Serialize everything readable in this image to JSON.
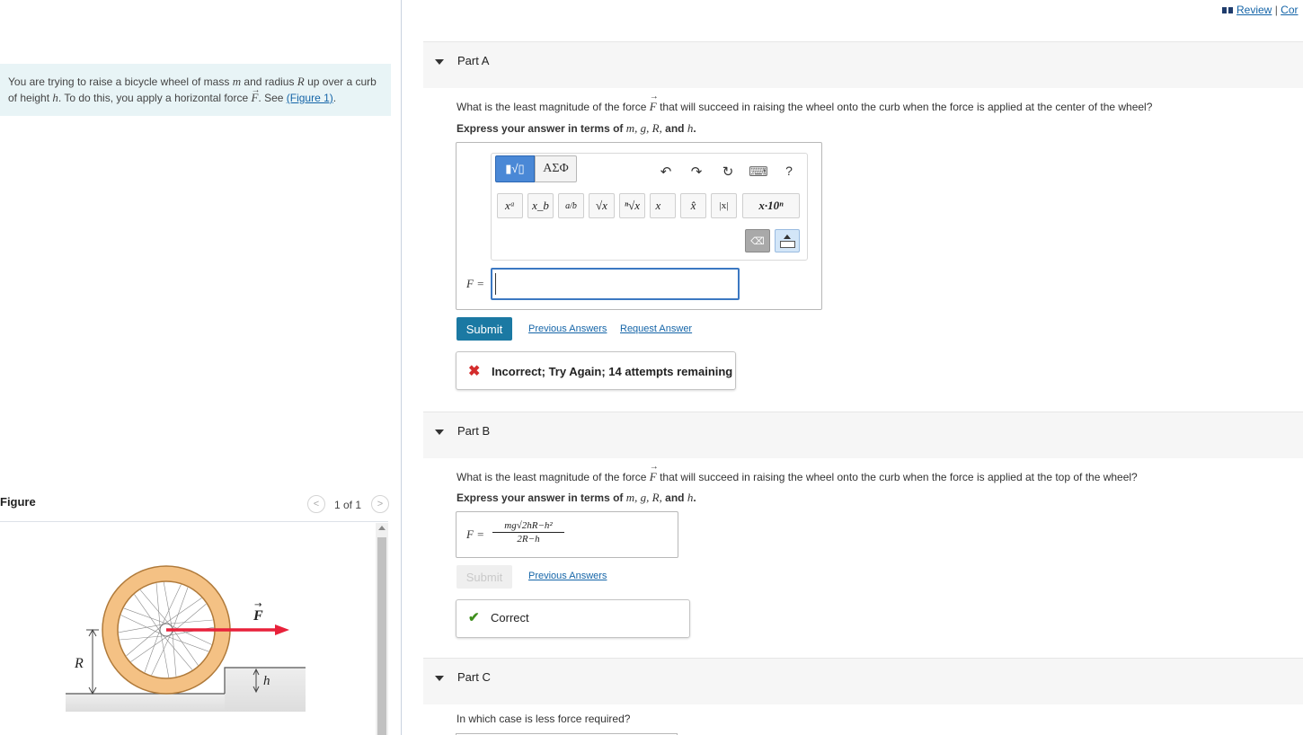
{
  "top_links": {
    "review": "Review",
    "separator": "|",
    "next": "Cor"
  },
  "intro": {
    "line1_a": "You are trying to raise a bicycle wheel of mass ",
    "m": "m",
    "line1_b": " and radius ",
    "R": "R",
    "line1_c": " up over a curb",
    "line2_a": "of height ",
    "h": "h",
    "line2_b": ". To do this, you apply a horizontal force ",
    "F": "F",
    "line2_c": ". See ",
    "figure_link": "(Figure 1)",
    "line2_d": "."
  },
  "figure": {
    "title": "Figure",
    "prev_glyph": "<",
    "page": "1 of 1",
    "next_glyph": ">",
    "label_F": "F",
    "label_R": "R",
    "label_h": "h"
  },
  "parts": {
    "a": {
      "title": "Part A",
      "question_a": "What is the least magnitude of the force ",
      "F": "F",
      "question_b": " that will succeed in raising the wheel onto the curb when the force is applied at the center of the wheel?",
      "express_prefix": "Express your answer in terms of ",
      "vars": "m, g, R,",
      "express_and": " and ",
      "last_var": "h",
      "express_suffix": ".",
      "toolbar": {
        "templates_glyph": "▮√▯",
        "symbols": "ΑΣΦ",
        "undo_icon": "↶",
        "redo_icon": "↷",
        "reset_icon": "↻",
        "keyboard_icon": "⌨",
        "help": "?",
        "templates": [
          "xᵃ",
          "x_b",
          "a/b",
          "√x",
          "ⁿ√x",
          "x⃗",
          "x̂",
          "|x|",
          "x·10ⁿ"
        ],
        "delete_glyph": "⌫"
      },
      "answer_label": "F =",
      "answer_value": "",
      "submit": "Submit",
      "previous_answers": "Previous Answers",
      "request_answer": "Request Answer",
      "feedback_icon": "✖",
      "feedback": "Incorrect; Try Again; 14 attempts remaining"
    },
    "b": {
      "title": "Part B",
      "question_a": "What is the least magnitude of the force ",
      "F": "F",
      "question_b": " that will succeed in raising the wheel onto the curb when the force is applied at the top of the wheel?",
      "express_prefix": "Express your answer in terms of ",
      "vars": "m, g, R,",
      "express_and": " and ",
      "last_var": "h",
      "express_suffix": ".",
      "answer_label": "F =",
      "answer_numerator": "mg√2hR−h²",
      "answer_denominator": "2R−h",
      "submit": "Submit",
      "previous_answers": "Previous Answers",
      "feedback_icon": "✔",
      "feedback": "Correct"
    },
    "c": {
      "title": "Part C",
      "question": "In which case is less force required?"
    }
  },
  "colors": {
    "accent_blue": "#1b79a3",
    "link_blue": "#1565a8",
    "intro_bg": "#e8f4f6",
    "error_red": "#d42d2d",
    "success_green": "#3f8f1d",
    "wheel_tire": "#f4c184",
    "force_arrow": "#e8213a"
  }
}
